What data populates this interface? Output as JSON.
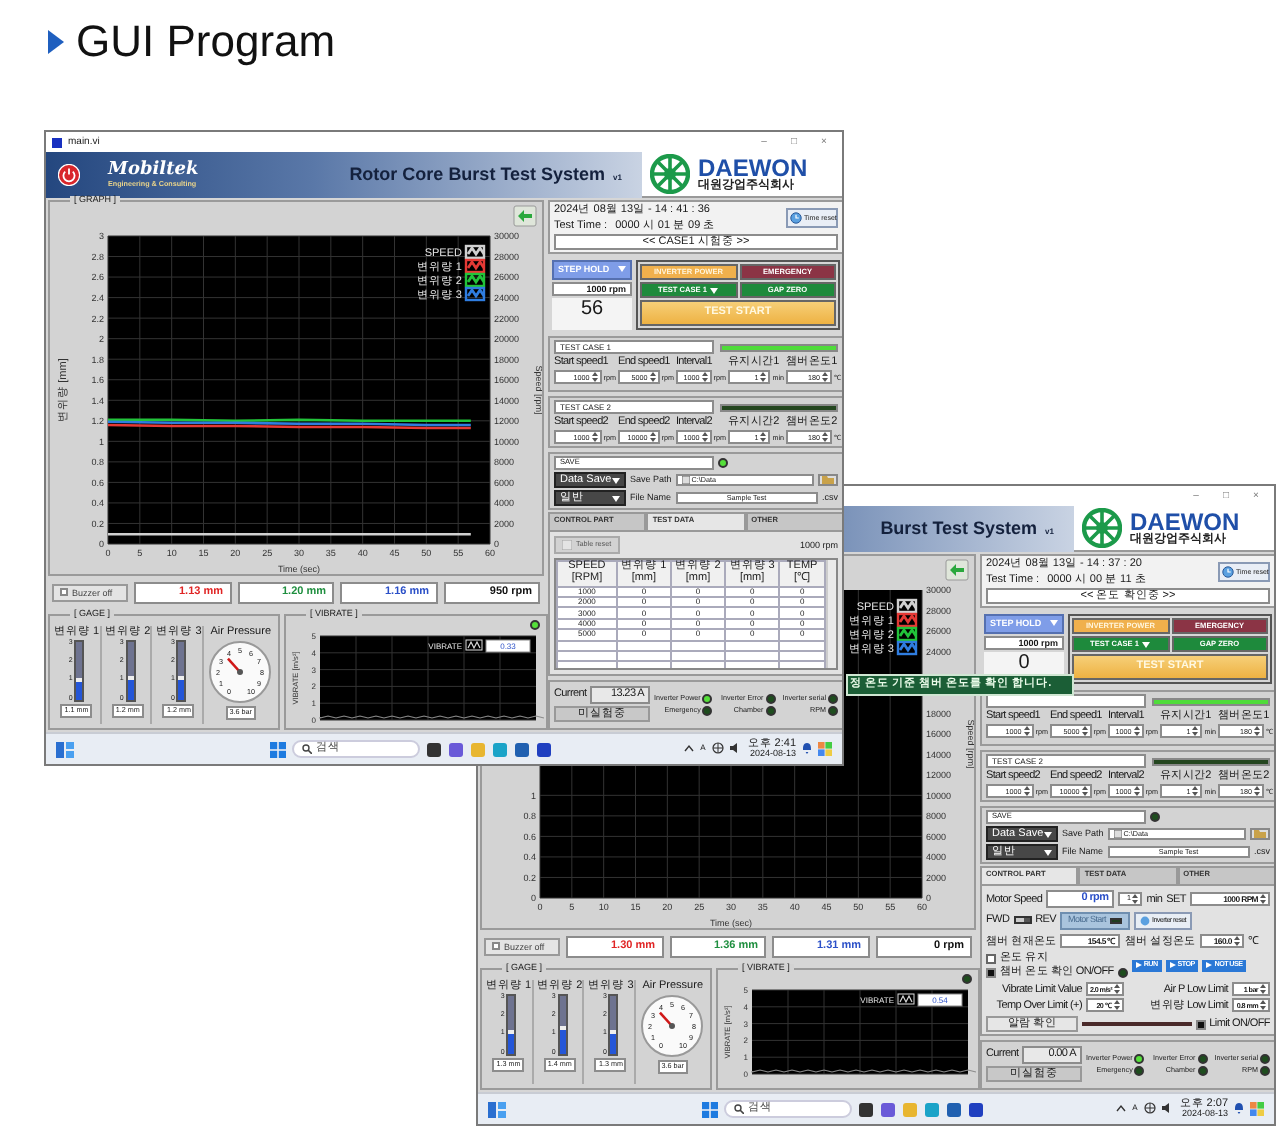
{
  "slide_title": "GUI Program",
  "front_window": {
    "title": "main.vi",
    "window_controls": [
      "–",
      "□",
      "×"
    ],
    "brand": "Mobiltek",
    "brand_tagline": "Engineering & Consulting",
    "app_title": "Rotor Core Burst Test System",
    "version": "v1",
    "company": "DAEWON",
    "company_korean": "대원강업주식회사",
    "graph": {
      "label": "[ GRAPH ]",
      "chart_data": {
        "type": "line",
        "xlabel": "Time (sec)",
        "ylabel": "변위량 [mm]",
        "y2label": "Speed [rpm]",
        "x": [
          0,
          10,
          20,
          30,
          40,
          50,
          57
        ],
        "series": [
          {
            "name": "SPEED",
            "color": "#d0d0d0",
            "axis": "y2",
            "values": [
              950,
              950,
              950,
              950,
              950,
              950,
              950
            ]
          },
          {
            "name": "변위량 1",
            "color": "#e53935",
            "values": [
              1.16,
              1.15,
              1.15,
              1.14,
              1.14,
              1.13,
              1.13
            ]
          },
          {
            "name": "변위량 2",
            "color": "#22c33a",
            "values": [
              1.21,
              1.21,
              1.2,
              1.21,
              1.2,
              1.2,
              1.2
            ]
          },
          {
            "name": "변위량 3",
            "color": "#2f7de0",
            "values": [
              1.19,
              1.18,
              1.18,
              1.17,
              1.17,
              1.16,
              1.16
            ]
          }
        ],
        "grid": true,
        "legend": "upper right",
        "xlim": [
          0,
          60
        ],
        "ylim": [
          0,
          3
        ],
        "y2lim": [
          0,
          30000
        ],
        "xticks": [
          0,
          5,
          10,
          15,
          20,
          25,
          30,
          35,
          40,
          45,
          50,
          55,
          60
        ],
        "yticks": [
          0,
          0.2,
          0.4,
          0.6,
          0.8,
          1,
          1.2,
          1.4,
          1.6,
          1.8,
          2,
          2.2,
          2.4,
          2.6,
          2.8,
          3
        ],
        "y2ticks": [
          0,
          2000,
          4000,
          6000,
          8000,
          10000,
          12000,
          14000,
          16000,
          18000,
          20000,
          22000,
          24000,
          26000,
          28000,
          30000
        ]
      }
    },
    "buzzer": {
      "label": "Buzzer off",
      "checked": false
    },
    "readouts": [
      {
        "value": "1.13 mm",
        "color": "#e02424"
      },
      {
        "value": "1.20 mm",
        "color": "#1f8f3f"
      },
      {
        "value": "1.16 mm",
        "color": "#2b50c8"
      },
      {
        "value": "950 rpm",
        "color": "#111111"
      }
    ],
    "gage": {
      "label": "[ GAGE ]",
      "bars": [
        {
          "name": "변위량 1",
          "scale": [
            "3",
            "2",
            "1",
            "0"
          ],
          "level": 0.37,
          "reading": "1.1 mm"
        },
        {
          "name": "변위량 2",
          "scale": [
            "3",
            "2",
            "1",
            "0"
          ],
          "level": 0.4,
          "reading": "1.2 mm"
        },
        {
          "name": "변위량 3",
          "scale": [
            "3",
            "2",
            "1",
            "0"
          ],
          "level": 0.4,
          "reading": "1.2 mm"
        }
      ],
      "pressure": {
        "name": "Air Pressure",
        "dial": [
          "0",
          "1",
          "2",
          "3",
          "4",
          "5",
          "6",
          "7",
          "8",
          "9",
          "10"
        ],
        "reading": "3.6 bar"
      }
    },
    "vibrate": {
      "label": "[ VIBRATE ]",
      "led_on": true,
      "ylabel": "VIBRATE [m/s²]",
      "yticks": [
        "5",
        "4",
        "3",
        "2",
        "1",
        "0"
      ],
      "legend": "VIBRATE",
      "value": "0.33"
    },
    "clock": {
      "datetime": "2024년 08월 13일 - 14 : 41 : 36",
      "test_time_label": "Test Time :",
      "test_time": "0000 시 01 분 09 초",
      "reset": "Time reset",
      "status": "<< CASE1 시험중 >>"
    },
    "control": {
      "mode": "STEP HOLD",
      "speed": "1000 rpm",
      "count": "56",
      "buttons": [
        {
          "kind": "power",
          "label": "INVERTER POWER"
        },
        {
          "kind": "emergency",
          "label": "EMERGENCY"
        },
        {
          "kind": "select",
          "label": "TEST CASE 1"
        },
        {
          "kind": "gap",
          "label": "GAP ZERO"
        },
        {
          "kind": "start",
          "label": "TEST START"
        }
      ]
    },
    "cases": [
      {
        "name": "TEST CASE 1",
        "active": true,
        "fields": [
          {
            "label": "Start speed1",
            "value": "1000",
            "unit": "rpm"
          },
          {
            "label": "End speed1",
            "value": "5000",
            "unit": "rpm"
          },
          {
            "label": "Interval1",
            "value": "1000",
            "unit": "rpm"
          },
          {
            "label": "유지시간1",
            "value": "1",
            "unit": "min"
          },
          {
            "label": "챔버온도1",
            "value": "180",
            "unit": "℃"
          }
        ]
      },
      {
        "name": "TEST CASE 2",
        "active": false,
        "fields": [
          {
            "label": "Start speed2",
            "value": "1000",
            "unit": "rpm"
          },
          {
            "label": "End speed2",
            "value": "10000",
            "unit": "rpm"
          },
          {
            "label": "Interval2",
            "value": "1000",
            "unit": "rpm"
          },
          {
            "label": "유지시간2",
            "value": "1",
            "unit": "min"
          },
          {
            "label": "챔버온도2",
            "value": "180",
            "unit": "℃"
          }
        ]
      }
    ],
    "save": {
      "label": "SAVE",
      "led_on": true,
      "mode": "Data Save",
      "path_label": "Save Path",
      "path": "C:\\Data",
      "type": "일반",
      "file_label": "File Name",
      "file_name": "Sample Test",
      "extension": ".csv"
    },
    "tabs": [
      {
        "label": "CONTROL PART",
        "selected": false
      },
      {
        "label": "TEST DATA",
        "selected": true
      },
      {
        "label": "OTHER",
        "selected": false
      }
    ],
    "test_data": {
      "reset": "Table reset",
      "speed": "1000 rpm",
      "columns": [
        "SPEED [RPM]",
        "변위량 1 [mm]",
        "변위량 2 [mm]",
        "변위량 3 [mm]",
        "TEMP [℃]"
      ],
      "rows": [
        [
          "1000",
          "0",
          "0",
          "0",
          "0"
        ],
        [
          "2000",
          "0",
          "0",
          "0",
          "0"
        ],
        [
          "3000",
          "0",
          "0",
          "0",
          "0"
        ],
        [
          "4000",
          "0",
          "0",
          "0",
          "0"
        ],
        [
          "5000",
          "0",
          "0",
          "0",
          "0"
        ]
      ]
    },
    "status": {
      "current_label": "Current",
      "current": "13.23 A",
      "state": "미실험중",
      "lamps": [
        {
          "label": "Inverter Power",
          "on": true
        },
        {
          "label": "Inverter Error",
          "on": false
        },
        {
          "label": "Inverter serial",
          "on": false
        },
        {
          "label": "Emergency",
          "on": false
        },
        {
          "label": "Chamber",
          "on": false
        },
        {
          "label": "RPM",
          "on": false
        }
      ]
    },
    "taskbar": {
      "search": "검색",
      "input_mode": "A",
      "time": "오후 2:41",
      "date": "2024-08-13"
    }
  },
  "back_window": {
    "window_controls": [
      "–",
      "□",
      "×"
    ],
    "app_title": "Burst Test System",
    "version": "v1",
    "company": "DAEWON",
    "company_korean": "대원강업주식회사",
    "graph": {
      "legend": [
        {
          "name": "SPEED",
          "color": "#d0d0d0"
        },
        {
          "name": "변위량 1",
          "color": "#e53935"
        },
        {
          "name": "변위량 2",
          "color": "#22c33a"
        },
        {
          "name": "변위량 3",
          "color": "#2f7de0"
        }
      ],
      "y2label": "Speed [rpm]",
      "xlabel": "Time (sec)",
      "grid": true,
      "xticks": [
        "0",
        "5",
        "10",
        "15",
        "20",
        "25",
        "30",
        "35",
        "40",
        "45",
        "50",
        "55",
        "60"
      ],
      "yticks": [
        "1",
        "0.8",
        "0.6",
        "0.4",
        "0.2",
        "0"
      ],
      "y2ticks": [
        "30000",
        "28000",
        "26000",
        "24000",
        "18000",
        "16000",
        "14000",
        "12000",
        "10000",
        "8000",
        "6000",
        "4000",
        "2000",
        "0"
      ]
    },
    "notice": "정 온도 기준  챔버 온도를 확인 합니다.",
    "buzzer": {
      "label": "Buzzer off",
      "checked": false
    },
    "readouts": [
      {
        "value": "1.30 mm",
        "color": "#e02424"
      },
      {
        "value": "1.36 mm",
        "color": "#1f8f3f"
      },
      {
        "value": "1.31 mm",
        "color": "#2b50c8"
      },
      {
        "value": "0 rpm",
        "color": "#111111"
      }
    ],
    "gage": {
      "label": "[ GAGE ]",
      "bars": [
        {
          "name": "변위량 1",
          "scale": [
            "3",
            "2",
            "1",
            "0"
          ],
          "level": 0.43,
          "reading": "1.3 mm"
        },
        {
          "name": "변위량 2",
          "scale": [
            "3",
            "2",
            "1",
            "0"
          ],
          "level": 0.47,
          "reading": "1.4 mm"
        },
        {
          "name": "변위량 3",
          "scale": [
            "3",
            "2",
            "1",
            "0"
          ],
          "level": 0.43,
          "reading": "1.3 mm"
        }
      ],
      "pressure": {
        "name": "Air Pressure",
        "dial": [
          "0",
          "1",
          "2",
          "3",
          "4",
          "5",
          "6",
          "7",
          "8",
          "9",
          "10"
        ],
        "reading": "3.6 bar"
      }
    },
    "vibrate": {
      "label": "[ VIBRATE ]",
      "led_on": false,
      "ylabel": "VIBRATE [m/s²]",
      "yticks": [
        "5",
        "4",
        "3",
        "2",
        "1",
        "0"
      ],
      "legend": "VIBRATE",
      "value": "0.54"
    },
    "clock": {
      "datetime": "2024년 08월 13일 - 14 : 37 : 20",
      "test_time_label": "Test Time :",
      "test_time": "0000 시 00 분 11 초",
      "reset": "Time reset",
      "status": "<< 온도 확인중 >>"
    },
    "control": {
      "mode": "STEP HOLD",
      "speed": "1000 rpm",
      "count": "0",
      "buttons": [
        {
          "kind": "power",
          "label": "INVERTER POWER"
        },
        {
          "kind": "emergency",
          "label": "EMERGENCY"
        },
        {
          "kind": "select",
          "label": "TEST CASE 1"
        },
        {
          "kind": "gap",
          "label": "GAP ZERO"
        },
        {
          "kind": "start",
          "label": "TEST START"
        }
      ]
    },
    "cases": [
      {
        "active": true,
        "fields": [
          {
            "label": "Start speed1",
            "value": "1000",
            "unit": "rpm"
          },
          {
            "label": "End speed1",
            "value": "5000",
            "unit": "rpm"
          },
          {
            "label": "Interval1",
            "value": "1000",
            "unit": "rpm"
          },
          {
            "label": "유지시간1",
            "value": "1",
            "unit": "min"
          },
          {
            "label": "챔버온도1",
            "value": "180",
            "unit": "℃"
          }
        ]
      },
      {
        "name": "TEST CASE 2",
        "active": false,
        "fields": [
          {
            "label": "Start speed2",
            "value": "1000",
            "unit": "rpm"
          },
          {
            "label": "End speed2",
            "value": "10000",
            "unit": "rpm"
          },
          {
            "label": "Interval2",
            "value": "1000",
            "unit": "rpm"
          },
          {
            "label": "유지시간2",
            "value": "1",
            "unit": "min"
          },
          {
            "label": "챔버온도2",
            "value": "180",
            "unit": "℃"
          }
        ]
      }
    ],
    "save": {
      "label": "SAVE",
      "led_on": false,
      "mode": "Data Save",
      "path_label": "Save Path",
      "path": "C:\\Data",
      "type": "일반",
      "file_label": "File Name",
      "file_name": "Sample Test",
      "extension": ".csv"
    },
    "tabs": [
      {
        "label": "CONTROL PART",
        "selected": true
      },
      {
        "label": "TEST DATA",
        "selected": false
      },
      {
        "label": "OTHER",
        "selected": false
      }
    ],
    "control_part": {
      "motor_speed_label": "Motor Speed",
      "motor_speed": "0 rpm",
      "duration": "1",
      "duration_unit": "min",
      "set_label": "SET",
      "set_speed": "1000 RPM",
      "fwd": "FWD",
      "reverse": false,
      "rev": "REV",
      "motor_start": "Motor Start",
      "motor_running": false,
      "inverter_reset": "Inverter reset",
      "chamber_temp_label": "챔버 현재온도",
      "chamber_temp": "154.5 ℃",
      "chamber_set_label": "챔버 설정온도",
      "chamber_set": "160.0",
      "chamber_set_unit": "℃",
      "hold_label": "온도 유지",
      "hold_checked": false,
      "check_label": "챔버 온도 확인 ON/OFF",
      "check_on": true,
      "check_led_on": false,
      "actions": [
        "RUN",
        "STOP",
        "NOT USE"
      ],
      "limits": [
        {
          "label": "Vibrate Limit Value",
          "value": "2.0 m/s²"
        },
        {
          "label": "Air P Low Limit",
          "value": "1 bar"
        },
        {
          "label": "Temp Over Limit (+)",
          "value": "20 ℃"
        },
        {
          "label": "변위량 Low Limit",
          "value": "0.8 mm"
        }
      ],
      "alarm": "알람 확인",
      "limit_label": "Limit ON/OFF",
      "limit_on": true
    },
    "status": {
      "current_label": "Current",
      "current": "0.00 A",
      "state": "미실험중",
      "lamps": [
        {
          "label": "Inverter Power",
          "on": true
        },
        {
          "label": "Inverter Error",
          "on": false
        },
        {
          "label": "Inverter serial",
          "on": false
        },
        {
          "label": "Emergency",
          "on": false
        },
        {
          "label": "Chamber",
          "on": false
        },
        {
          "label": "RPM",
          "on": false
        }
      ]
    },
    "taskbar": {
      "search": "검색",
      "input_mode": "A",
      "time": "오후 2:07",
      "date": "2024-08-13"
    }
  }
}
